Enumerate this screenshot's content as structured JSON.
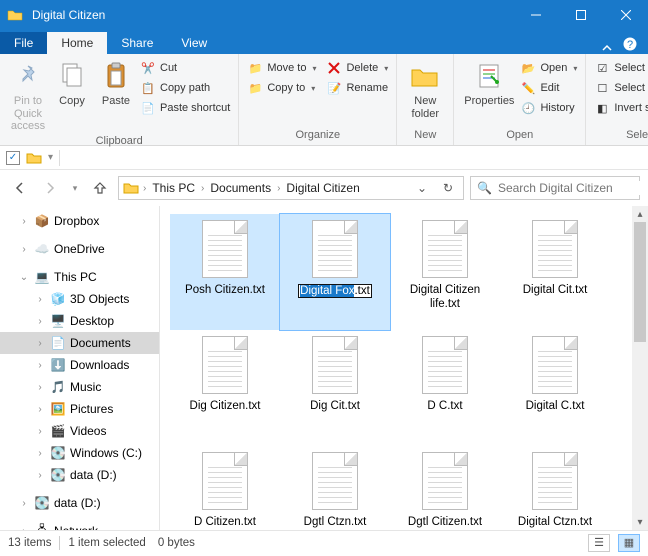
{
  "window": {
    "title": "Digital Citizen"
  },
  "tabs": {
    "file": "File",
    "home": "Home",
    "share": "Share",
    "view": "View"
  },
  "ribbon": {
    "clipboard": {
      "label": "Clipboard",
      "pin": "Pin to Quick\naccess",
      "copy": "Copy",
      "paste": "Paste",
      "cut": "Cut",
      "copy_path": "Copy path",
      "paste_shortcut": "Paste shortcut"
    },
    "organize": {
      "label": "Organize",
      "move_to": "Move to",
      "copy_to": "Copy to",
      "delete": "Delete",
      "rename": "Rename"
    },
    "new": {
      "label": "New",
      "new_folder": "New\nfolder"
    },
    "open": {
      "label": "Open",
      "properties": "Properties",
      "open": "Open",
      "edit": "Edit",
      "history": "History"
    },
    "select": {
      "label": "Select",
      "select_all": "Select all",
      "select_none": "Select none",
      "invert": "Invert selection"
    }
  },
  "breadcrumbs": {
    "root": "This PC",
    "a": "Documents",
    "b": "Digital Citizen"
  },
  "search": {
    "placeholder": "Search Digital Citizen"
  },
  "tree": {
    "dropbox": "Dropbox",
    "onedrive": "OneDrive",
    "thispc": "This PC",
    "objects3d": "3D Objects",
    "desktop": "Desktop",
    "documents": "Documents",
    "downloads": "Downloads",
    "music": "Music",
    "pictures": "Pictures",
    "videos": "Videos",
    "windowsc": "Windows (C:)",
    "datad1": "data (D:)",
    "datad2": "data (D:)",
    "network": "Network"
  },
  "files": {
    "f0": "Posh Citizen.txt",
    "f1_name": "Digital Fox",
    "f1_ext": ".txt",
    "f2": "Digital Citizen life.txt",
    "f3": "Digital Cit.txt",
    "f4": "Dig Citizen.txt",
    "f5": "Dig Cit.txt",
    "f6": "D C.txt",
    "f7": "Digital C.txt",
    "f8": "D Citizen.txt",
    "f9": "Dgtl Ctzn.txt",
    "f10": "Dgtl Citizen.txt",
    "f11": "Digital Ctzn.txt"
  },
  "status": {
    "items": "13 items",
    "selected": "1 item selected",
    "size": "0 bytes"
  }
}
